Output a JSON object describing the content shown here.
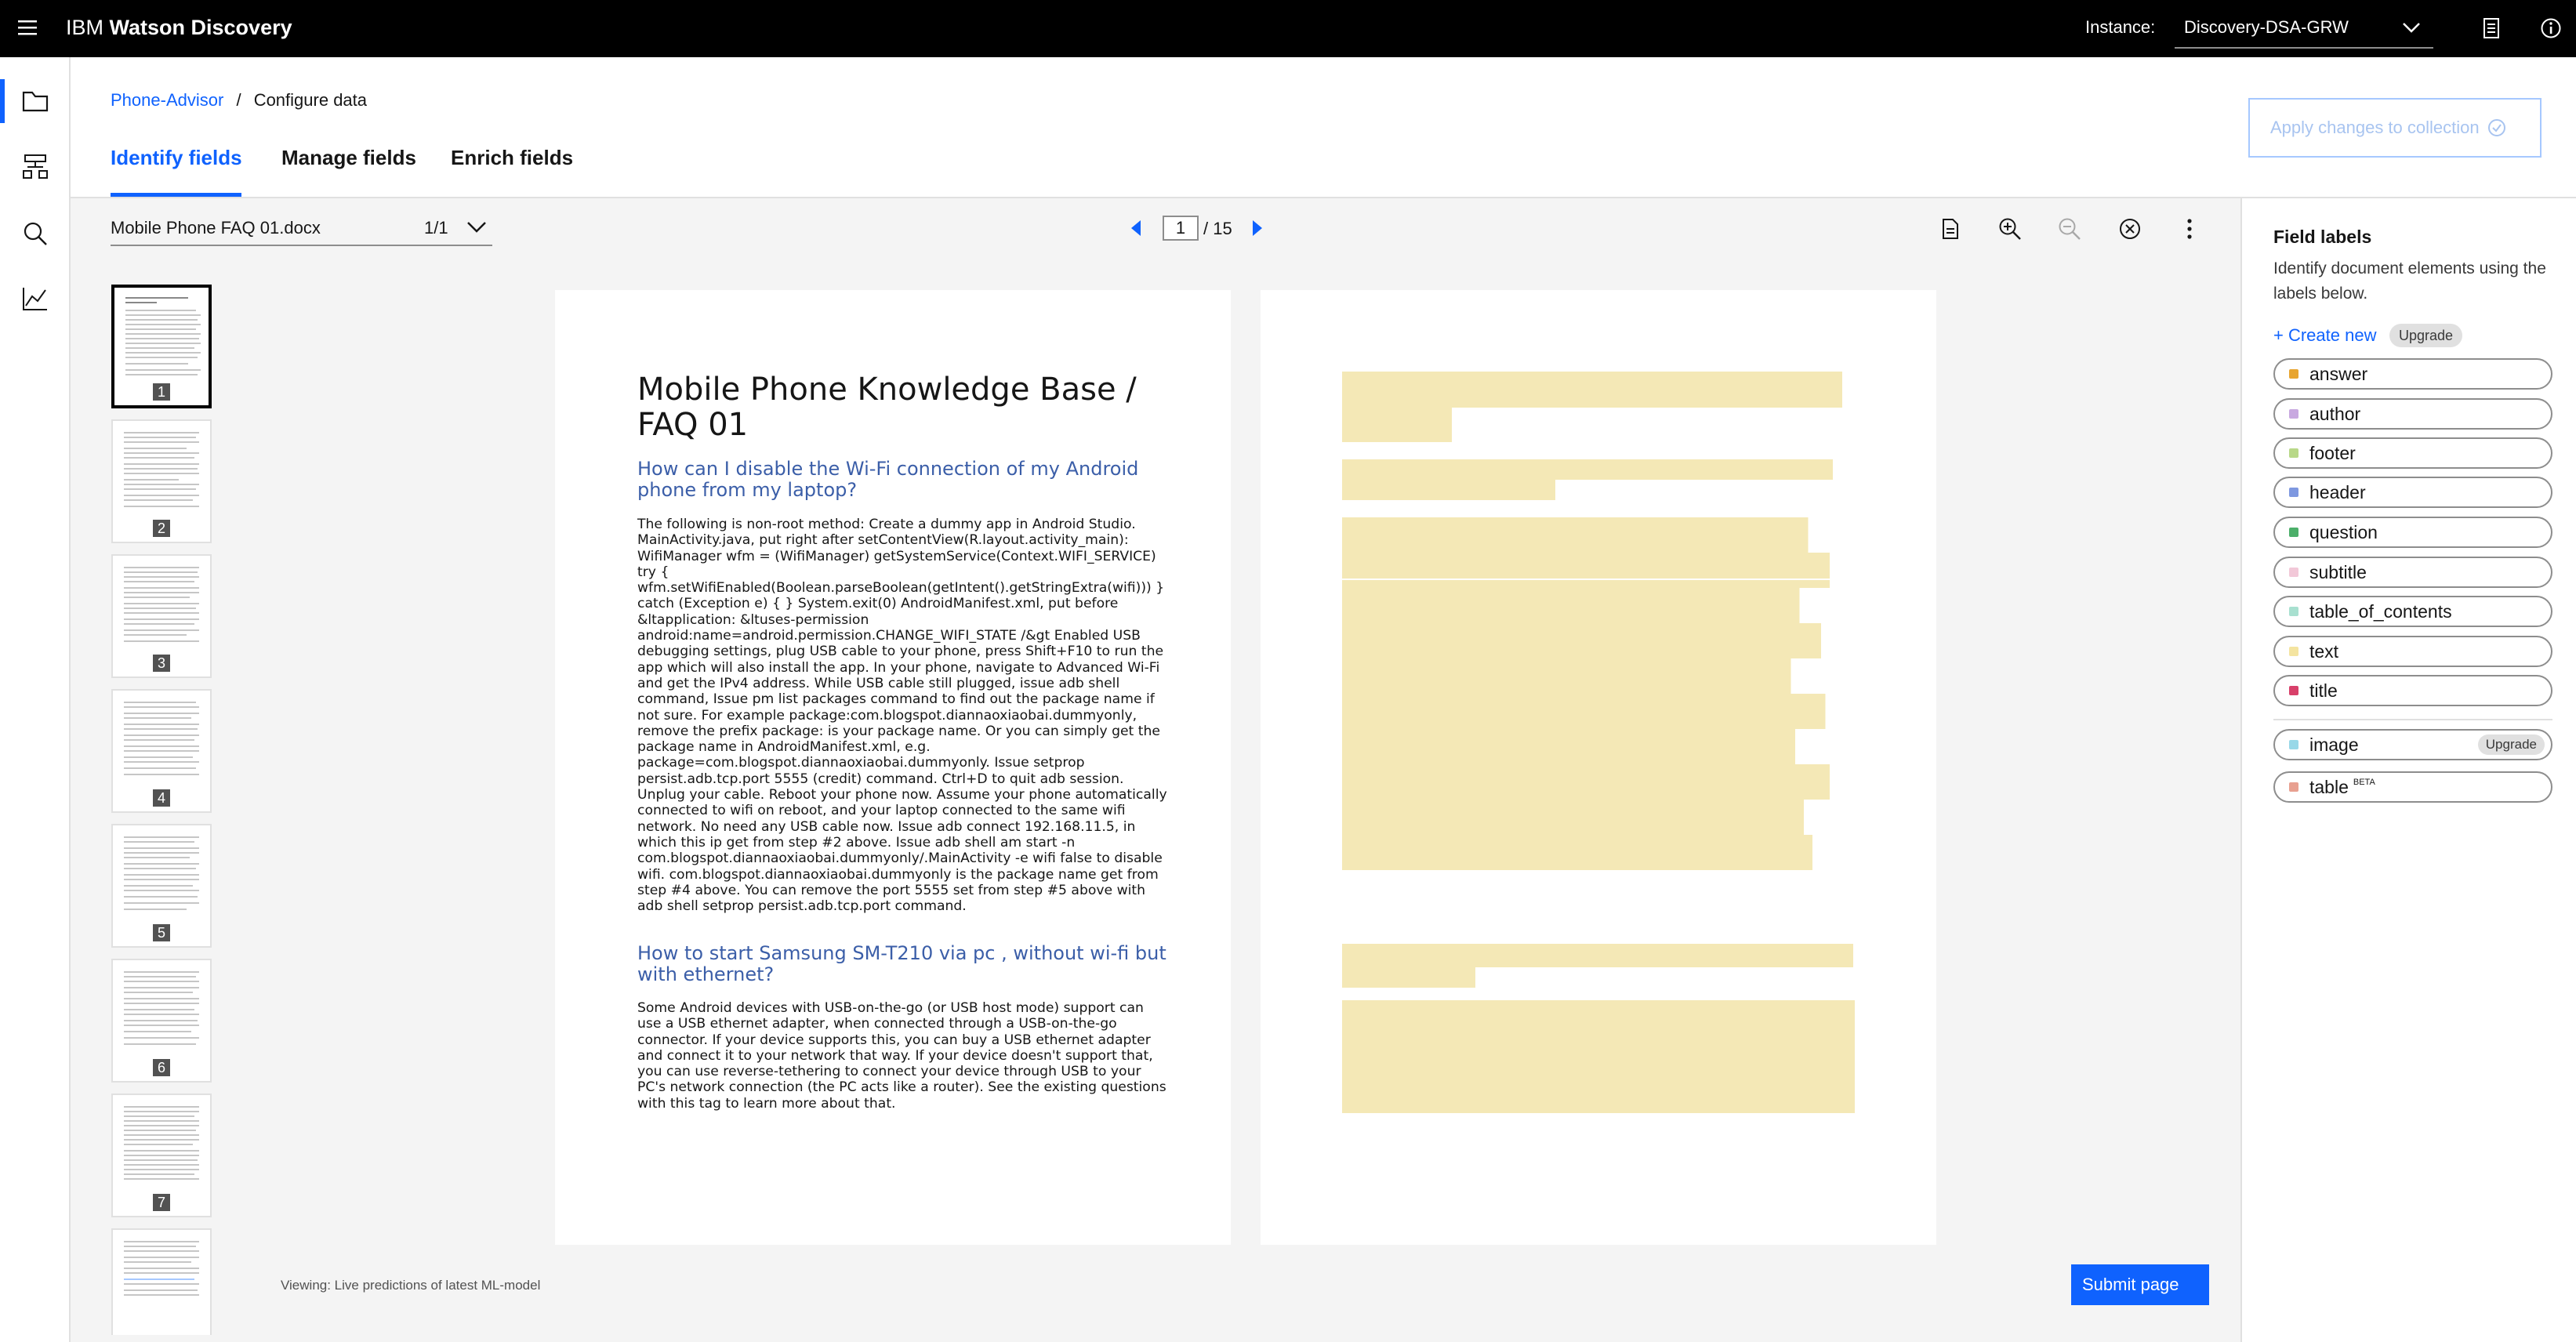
{
  "app": {
    "brand_prefix": "IBM",
    "brand_name": "Watson Discovery",
    "instance_label": "Instance:",
    "instance_value": "Discovery-DSA-GRW"
  },
  "nav": {
    "icons": [
      "folder-icon",
      "data-flow-icon",
      "search-icon",
      "chart-icon"
    ]
  },
  "breadcrumb": {
    "project": "Phone-Advisor",
    "separator": "/",
    "current": "Configure data"
  },
  "tabs": [
    "Identify fields",
    "Manage fields",
    "Enrich fields"
  ],
  "apply_button": "Apply changes to collection",
  "toolbar": {
    "document_name": "Mobile Phone FAQ 01.docx",
    "document_count": "1/1",
    "page_current": "1",
    "page_total": "/ 15"
  },
  "thumbnails": [
    "1",
    "2",
    "3",
    "4",
    "5",
    "6",
    "7"
  ],
  "document": {
    "title": "Mobile Phone Knowledge Base / FAQ 01",
    "q1": "How can I disable the Wi-Fi connection of my Android phone from my laptop?",
    "a1": "The following is non-root method: Create a dummy app in Android Studio. MainActivity.java, put right after setContentView(R.layout.activity_main): WifiManager wfm = (WifiManager) getSystemService(Context.WIFI_SERVICE) try { wfm.setWifiEnabled(Boolean.parseBoolean(getIntent().getStringExtra(wifi))) } catch (Exception e) { } System.exit(0) AndroidManifest.xml, put before &ltapplication: &ltuses-permission android:name=android.permission.CHANGE_WIFI_STATE /&gt Enabled USB debugging settings, plug USB cable to your phone, press Shift+F10 to run the app which will also install the app. In your phone, navigate to Advanced Wi-Fi and get the IPv4 address. While USB cable still plugged, issue adb shell command, Issue pm list packages command to find out the package name if not sure. For example package:com.blogspot.diannaoxiaobai.dummyonly, remove the prefix package: is your package name. Or you can simply get the package name in AndroidManifest.xml, e.g. package=com.blogspot.diannaoxiaobai.dummyonly. Issue setprop persist.adb.tcp.port 5555 (credit) command. Ctrl+D to quit adb session. Unplug your cable. Reboot your phone now. Assume your phone automatically connected to wifi on reboot, and your laptop connected to the same wifi network. No need any USB cable now. Issue adb connect 192.168.11.5, in which this ip get from step #2 above. Issue adb shell am start -n com.blogspot.diannaoxiaobai.dummyonly/.MainActivity -e wifi false to disable wifi. com.blogspot.diannaoxiaobai.dummyonly is the package name get from step #4 above. You can remove the port 5555 set from step #5 above with adb shell setprop persist.adb.tcp.port command.",
    "q2": "How to start Samsung SM-T210 via pc , without wi-fi but with ethernet?",
    "a2": "Some Android devices with USB-on-the-go (or USB host mode) support can use a USB ethernet adapter, when connected through a USB-on-the-go connector. If your device supports this, you can buy a USB ethernet adapter and connect it to your network that way. If your device doesn't support that, you can use reverse-tethering to connect your device through USB to your PC's network connection (the PC acts like a router). See the existing questions with this tag to learn more about that."
  },
  "status_text": "Viewing: Live predictions of latest ML-model",
  "submit_button": "Submit page",
  "panel": {
    "title": "Field labels",
    "description": "Identify document elements using the labels below.",
    "create_new": "+ Create new",
    "upgrade": "Upgrade",
    "labels": [
      {
        "name": "answer",
        "color": "#e8a530"
      },
      {
        "name": "author",
        "color": "#c8a8e0"
      },
      {
        "name": "footer",
        "color": "#b8d888"
      },
      {
        "name": "header",
        "color": "#7e98e0"
      },
      {
        "name": "question",
        "color": "#4caf6a"
      },
      {
        "name": "subtitle",
        "color": "#f2c8d8"
      },
      {
        "name": "table_of_contents",
        "color": "#a8e0d0"
      },
      {
        "name": "text",
        "color": "#f4e4a0"
      },
      {
        "name": "title",
        "color": "#d8406a"
      }
    ],
    "image_label": "image",
    "image_color": "#98d8e8",
    "image_upgrade": "Upgrade",
    "table_label": "table",
    "table_badge": "BETA",
    "table_color": "#e8a090"
  }
}
